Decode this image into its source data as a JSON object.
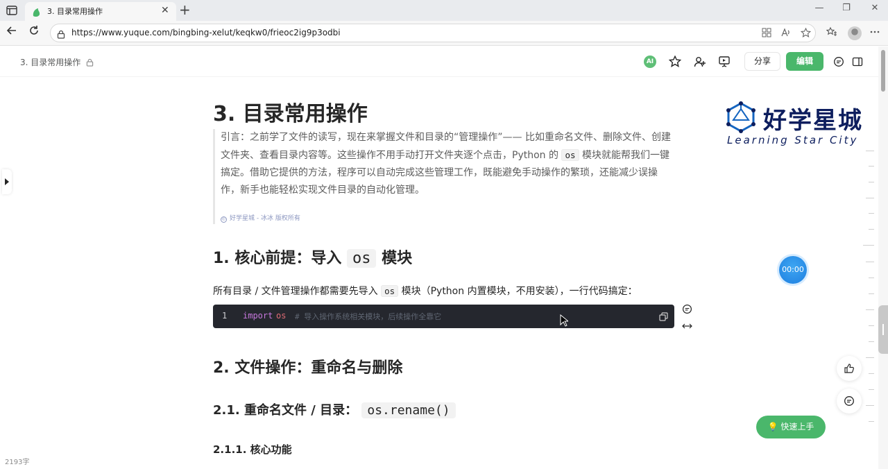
{
  "browser": {
    "tab_title": "3. 目录常用操作",
    "tab_close": "✕",
    "new_tab": "+",
    "url": "https://www.yuque.com/bingbing-xelut/keqkw0/frieoc2ig9p3odbi",
    "window": {
      "minimize": "—",
      "maximize": "❐",
      "close": "✕"
    }
  },
  "header": {
    "breadcrumb": "3. 目录常用操作",
    "ai_label": "AI",
    "share_label": "分享",
    "edit_label": "编辑"
  },
  "doc": {
    "title": "3. 目录常用操作",
    "quote": {
      "part1": "引言：之前学了文件的读写，现在来掌握文件和目录的“管理操作”—— 比如重命名文件、删除文件、创建文件夹、查看目录内容等。这些操作不用手动打开文件夹逐个点击，Python 的 ",
      "code": "os",
      "part2": " 模块就能帮我们一键搞定。借助它提供的方法，程序可以自动完成这些管理工作，既能避免手动操作的繁琐，还能减少误操作，新手也能轻松实现文件目录的自动化管理。"
    },
    "copyright": "好学星城 - 冰冰 版权所有",
    "h1": {
      "prefix": "1. 核心前提：导入 ",
      "code": "os",
      "suffix": " 模块"
    },
    "para": {
      "prefix": "所有目录 / 文件管理操作都需要先导入 ",
      "code": "os",
      "suffix": " 模块（Python 内置模块，不用安装），一行代码搞定："
    },
    "codeblock": {
      "line_number": "1",
      "keyword": "import",
      "module": "os",
      "comment": "# 导入操作系统相关模块，后续操作全靠它"
    },
    "h2": "2. 文件操作：重命名与删除",
    "h3": {
      "prefix": "2.1. 重命名文件 / 目录： ",
      "code": "os.rename()"
    },
    "h4": "2.1.1. 核心功能"
  },
  "logo": {
    "cn": "好学星城",
    "en": "Learning Star City"
  },
  "timer": "00:00",
  "quickstart": "💡 快速上手",
  "wordcount": "2193字",
  "colors": {
    "accent": "#4ab76b",
    "timer": "#1e7fe0",
    "code_bg": "#25272e"
  }
}
